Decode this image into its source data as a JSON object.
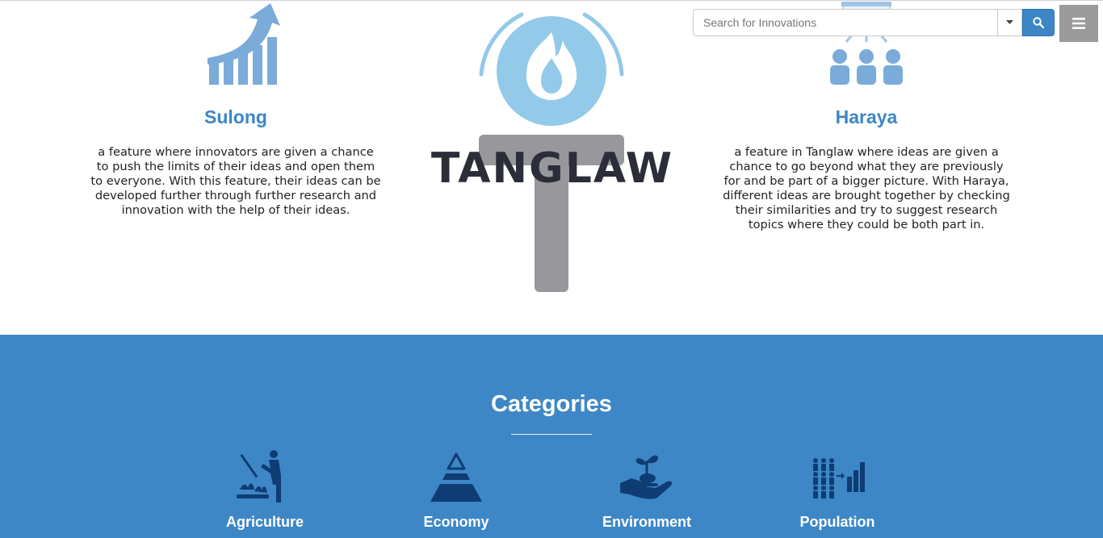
{
  "search": {
    "placeholder": "Search for Innovations"
  },
  "features": [
    {
      "title": "Sulong",
      "icon": "growth-chart-icon",
      "description": "a feature where innovators are given a chance to push the limits of their ideas and open them to everyone. With this feature, their ideas can be developed further through further research and innovation with the help of their ideas."
    },
    {
      "title": "Haraya",
      "icon": "group-presentation-icon",
      "description": "a feature in Tanglaw where ideas are given a chance to go beyond what they are previously for and be part of a bigger picture. With Haraya, different ideas are brought together by checking their similarities and try to suggest research topics where they could be both part in."
    }
  ],
  "logo": {
    "text": "TANGLAW"
  },
  "categories": {
    "title": "Categories",
    "items": [
      {
        "label": "Agriculture",
        "icon": "farmer-icon"
      },
      {
        "label": "Economy",
        "icon": "pyramid-icon"
      },
      {
        "label": "Environment",
        "icon": "hand-plant-icon"
      },
      {
        "label": "Population",
        "icon": "population-chart-icon"
      }
    ]
  },
  "colors": {
    "accent": "#3d86c6",
    "band": "#3e87c6",
    "icon_light": "#7aabd9",
    "logo_flame": "#93c9e9",
    "logo_handle": "#97979c",
    "logo_text": "#2b2e38",
    "category_icon": "#0e3c73",
    "menu_button": "#9b9b9b"
  }
}
